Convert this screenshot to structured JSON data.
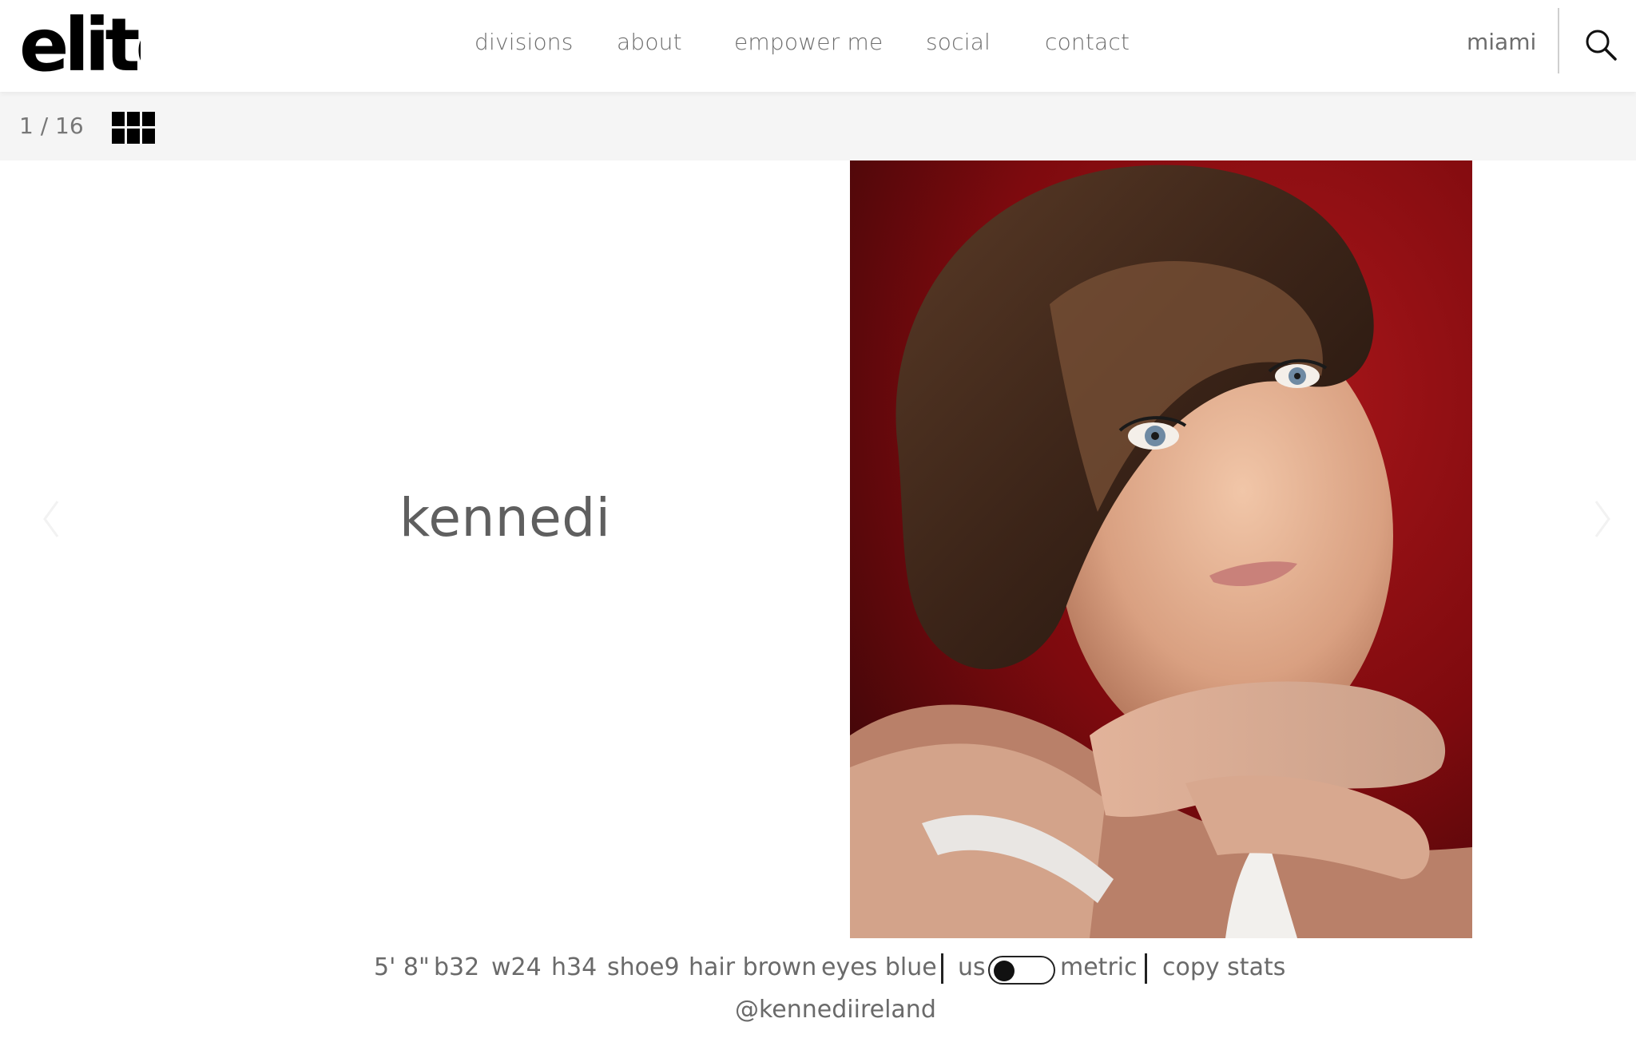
{
  "header": {
    "logo_text": "elite",
    "nav": [
      {
        "label": "divisions"
      },
      {
        "label": "about"
      },
      {
        "label": "empower me"
      },
      {
        "label": "social"
      },
      {
        "label": "contact"
      }
    ],
    "city": "miami",
    "search_icon": "search-icon"
  },
  "subbar": {
    "counter": "1 / 16",
    "grid_icon": "grid-view-icon"
  },
  "model": {
    "name": "kennedi",
    "photo_description_icon": "portrait-photo",
    "colors": {
      "photo_background": "#8e0b0f",
      "text": "#666666",
      "subbar_background": "#f5f5f5"
    }
  },
  "stats": {
    "height": "5' 8\"",
    "bust": "b32",
    "waist": "w24",
    "hips": "h34",
    "shoe": "shoe9",
    "hair": "hair brown",
    "eyes": "eyes blue",
    "unit_us": "us",
    "unit_metric": "metric",
    "copy": "copy stats",
    "toggle_state": "us"
  },
  "instagram": "@kennediireland"
}
